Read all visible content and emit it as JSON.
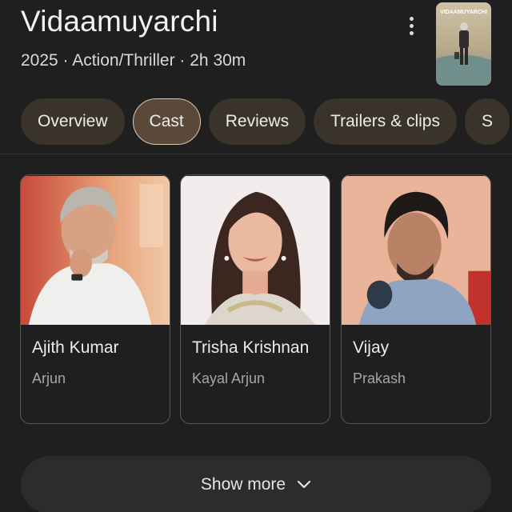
{
  "header": {
    "title": "Vidaamuyarchi",
    "meta": "2025 · Action/Thriller · 2h 30m",
    "poster_text": "VIDAAMUYARCHI"
  },
  "tabs": [
    {
      "label": "Overview"
    },
    {
      "label": "Cast",
      "active": true
    },
    {
      "label": "Reviews"
    },
    {
      "label": "Trailers & clips"
    },
    {
      "label": "S"
    }
  ],
  "cast": [
    {
      "name": "Ajith Kumar",
      "role": "Arjun"
    },
    {
      "name": "Trisha Krishnan",
      "role": "Kayal Arjun"
    },
    {
      "name": "Vijay",
      "role": "Prakash"
    }
  ],
  "show_more": {
    "label": "Show more",
    "icon": "chevron-down-icon"
  },
  "colors": {
    "background": "#1f1f1f",
    "tab_bg": "#3a332a",
    "tab_active_bg": "#5a4838",
    "tab_active_border": "#d9c8b4"
  }
}
